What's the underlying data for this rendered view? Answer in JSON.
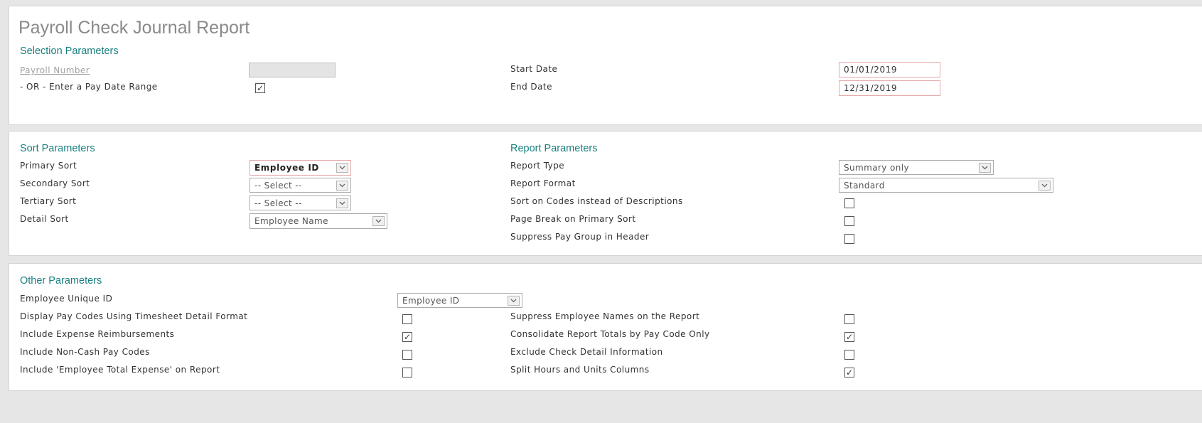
{
  "title": "Payroll Check Journal Report",
  "selection": {
    "heading": "Selection Parameters",
    "payroll_number_label": "Payroll Number",
    "pay_date_range_label": "- OR - Enter a Pay Date Range",
    "pay_date_range_checked": true,
    "start_date_label": "Start Date",
    "start_date_value": "01/01/2019",
    "end_date_label": "End Date",
    "end_date_value": "12/31/2019"
  },
  "sort": {
    "heading": "Sort Parameters",
    "primary_label": "Primary Sort",
    "primary_value": "Employee ID",
    "secondary_label": "Secondary Sort",
    "secondary_value": "-- Select --",
    "tertiary_label": "Tertiary Sort",
    "tertiary_value": "-- Select --",
    "detail_label": "Detail Sort",
    "detail_value": "Employee Name"
  },
  "report": {
    "heading": "Report Parameters",
    "type_label": "Report Type",
    "type_value": "Summary only",
    "format_label": "Report Format",
    "format_value": "Standard",
    "sort_codes_label": "Sort on Codes instead of Descriptions",
    "sort_codes_checked": false,
    "page_break_label": "Page Break on Primary Sort",
    "page_break_checked": false,
    "suppress_pay_group_label": "Suppress Pay Group in Header",
    "suppress_pay_group_checked": false
  },
  "other": {
    "heading": "Other Parameters",
    "unique_id_label": "Employee Unique ID",
    "unique_id_value": "Employee ID",
    "display_pay_codes_label": "Display Pay Codes Using Timesheet Detail Format",
    "display_pay_codes_checked": false,
    "include_expense_label": "Include Expense Reimbursements",
    "include_expense_checked": true,
    "include_non_cash_label": "Include Non-Cash Pay Codes",
    "include_non_cash_checked": false,
    "include_total_expense_label": "Include 'Employee Total Expense' on Report",
    "include_total_expense_checked": false,
    "suppress_names_label": "Suppress Employee Names on the Report",
    "suppress_names_checked": false,
    "consolidate_label": "Consolidate Report Totals by Pay Code Only",
    "consolidate_checked": true,
    "exclude_detail_label": "Exclude Check Detail Information",
    "exclude_detail_checked": false,
    "split_hours_label": "Split Hours and Units Columns",
    "split_hours_checked": true
  }
}
